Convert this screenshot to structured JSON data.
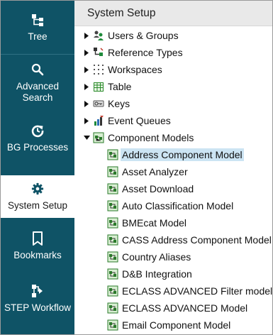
{
  "sidebar": {
    "items": [
      {
        "label": "Tree",
        "icon": "tree-icon",
        "active": false
      },
      {
        "label": "Advanced Search",
        "icon": "search-icon",
        "active": false
      },
      {
        "label": "BG Processes",
        "icon": "refresh-icon",
        "active": false
      },
      {
        "label": "System Setup",
        "icon": "gear-icon",
        "active": true
      },
      {
        "label": "Bookmarks",
        "icon": "bookmark-icon",
        "active": false
      },
      {
        "label": "STEP Workflow",
        "icon": "workflow-icon",
        "active": false
      }
    ]
  },
  "header": {
    "title": "System Setup"
  },
  "tree": {
    "top_level": [
      {
        "label": "Users & Groups",
        "icon": "users-icon",
        "expanded": false
      },
      {
        "label": "Reference Types",
        "icon": "reference-types-icon",
        "expanded": false
      },
      {
        "label": "Workspaces",
        "icon": "workspaces-icon",
        "expanded": false
      },
      {
        "label": "Table",
        "icon": "table-icon",
        "expanded": false
      },
      {
        "label": "Keys",
        "icon": "keys-icon",
        "expanded": false
      },
      {
        "label": "Event Queues",
        "icon": "event-queues-icon",
        "expanded": false
      },
      {
        "label": "Component Models",
        "icon": "component-models-icon",
        "expanded": true
      }
    ],
    "component_models": [
      {
        "label": "Address Component Model",
        "selected": true
      },
      {
        "label": "Asset Analyzer",
        "selected": false
      },
      {
        "label": "Asset Download",
        "selected": false
      },
      {
        "label": "Auto Classification Model",
        "selected": false
      },
      {
        "label": "BMEcat Model",
        "selected": false
      },
      {
        "label": "CASS Address Component Model",
        "selected": false
      },
      {
        "label": "Country Aliases",
        "selected": false
      },
      {
        "label": "D&B Integration",
        "selected": false
      },
      {
        "label": "ECLASS ADVANCED Filter model",
        "selected": false
      },
      {
        "label": "ECLASS ADVANCED Model",
        "selected": false
      },
      {
        "label": "Email Component Model",
        "selected": false
      }
    ],
    "colors": {
      "selection": "#cce4f3",
      "sidebar": "#0f5366"
    }
  }
}
